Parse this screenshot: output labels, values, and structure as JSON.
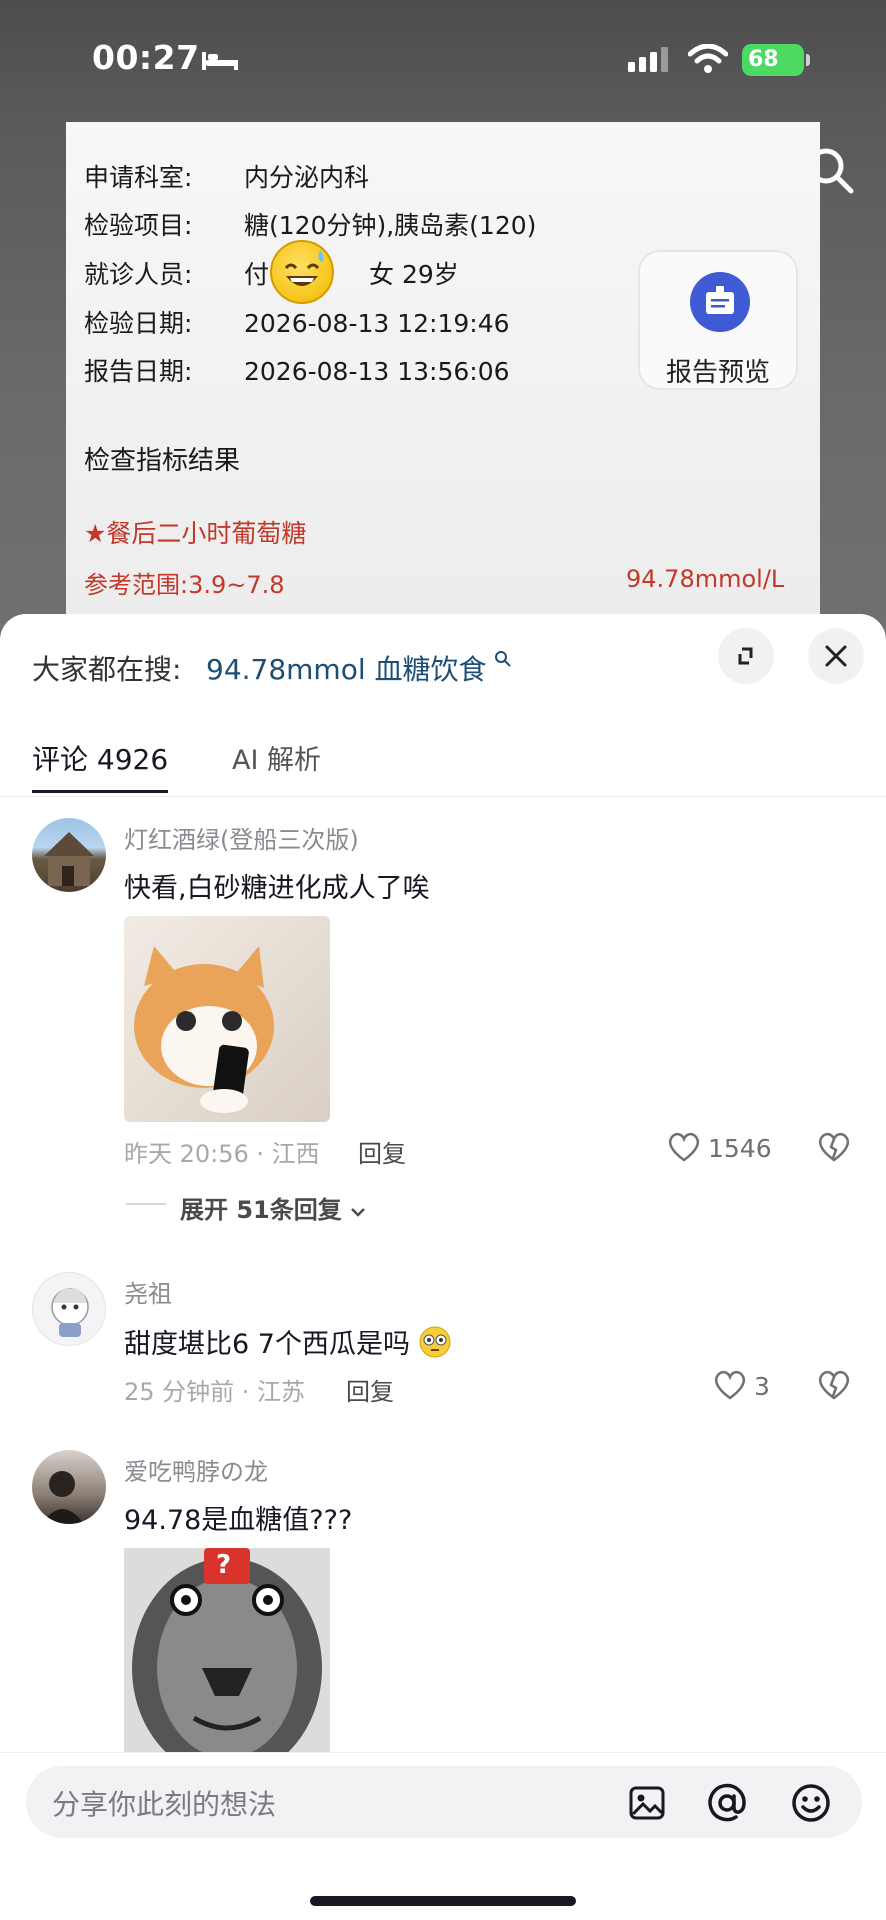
{
  "status_bar": {
    "time": "00:27",
    "battery": "68"
  },
  "report": {
    "rows": [
      {
        "label": "申请科室:",
        "value": "内分泌内科"
      },
      {
        "label": "检验项目:",
        "value": "糖(120分钟),胰岛素(120)"
      },
      {
        "label": "就诊人员:",
        "value_prefix": "付",
        "value_suffix": "女   29岁"
      },
      {
        "label": "检验日期:",
        "value": "2026-08-13 12:19:46"
      },
      {
        "label": "报告日期:",
        "value": "2026-08-13 13:56:06"
      }
    ],
    "preview_label": "报告预览",
    "section_title": "检查指标结果",
    "result_name": "★餐后二小时葡萄糖",
    "result_range": "参考范围:3.9~7.8",
    "result_value": "94.78mmol/L"
  },
  "hot_search": {
    "prefix": "大家都在搜:",
    "query": "94.78mmol 血糖饮食"
  },
  "tabs": [
    {
      "label": "评论 4926",
      "active": true
    },
    {
      "label": "AI 解析",
      "active": false
    }
  ],
  "comments": [
    {
      "name": "灯红酒绿(登船三次版)",
      "text": "快看,白砂糖进化成人了唉",
      "time_loc": "昨天 20:56 · 江西",
      "reply": "回复",
      "likes": "1546",
      "expand": "展开 51条回复"
    },
    {
      "name": "尧祖",
      "text": "甜度堪比6   7个西瓜是吗",
      "time_loc": "25 分钟前 · 江苏",
      "reply": "回复",
      "likes": "3"
    },
    {
      "name": "爱吃鸭脖の龙",
      "text": "94.78是血糖值???",
      "badge": "?"
    }
  ],
  "input": {
    "placeholder": "分享你此刻的想法"
  },
  "colors": {
    "accent_red": "#c0392b",
    "query_blue": "#1d4e73",
    "battery_green": "#4cd964"
  }
}
